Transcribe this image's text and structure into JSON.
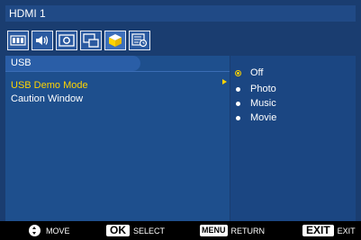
{
  "window": {
    "title": "HDMI 1"
  },
  "icon_tabs": [
    {
      "name": "picture-icon"
    },
    {
      "name": "audio-icon"
    },
    {
      "name": "screen-icon"
    },
    {
      "name": "pip-icon"
    },
    {
      "name": "configuration-icon"
    },
    {
      "name": "advanced-icon"
    }
  ],
  "section": {
    "title": "USB"
  },
  "menu": {
    "items": [
      {
        "label": "USB Demo Mode",
        "selected": true
      },
      {
        "label": "Caution Window",
        "selected": false
      }
    ]
  },
  "options": {
    "items": [
      {
        "label": "Off",
        "selected": true
      },
      {
        "label": "Photo",
        "selected": false
      },
      {
        "label": "Music",
        "selected": false
      },
      {
        "label": "Movie",
        "selected": false
      }
    ]
  },
  "footer": {
    "move": "MOVE",
    "ok_key": "OK",
    "select": "SELECT",
    "menu_key": "MENU",
    "return": "RETURN",
    "exit_key": "EXIT",
    "exit": "EXIT"
  },
  "colors": {
    "background": "#1a3d70",
    "highlight": "#ffd400",
    "text": "#ffffff"
  }
}
